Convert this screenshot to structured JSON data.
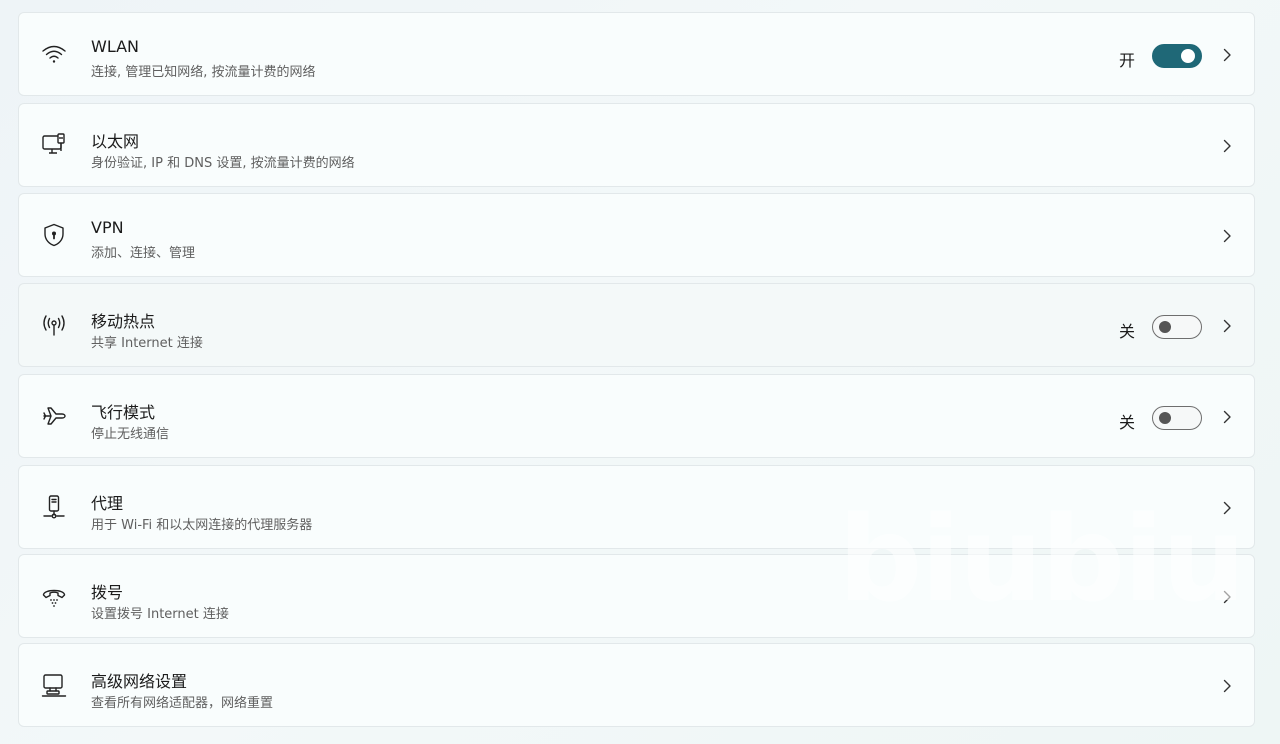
{
  "items": [
    {
      "title": "WLAN",
      "subtitle": "连接, 管理已知网络, 按流量计费的网络",
      "icon": "wifi-icon",
      "toggle": "on",
      "state": "开"
    },
    {
      "title": "以太网",
      "subtitle": "身份验证, IP 和 DNS 设置, 按流量计费的网络",
      "icon": "ethernet-icon"
    },
    {
      "title": "VPN",
      "subtitle": "添加、连接、管理",
      "icon": "shield-icon"
    },
    {
      "title": "移动热点",
      "subtitle": "共享 Internet 连接",
      "icon": "hotspot-icon",
      "toggle": "off",
      "state": "关"
    },
    {
      "title": "飞行模式",
      "subtitle": "停止无线通信",
      "icon": "airplane-icon",
      "toggle": "off",
      "state": "关"
    },
    {
      "title": "代理",
      "subtitle": "用于 Wi-Fi 和以太网连接的代理服务器",
      "icon": "proxy-icon"
    },
    {
      "title": "拨号",
      "subtitle": "设置拨号 Internet 连接",
      "icon": "dialup-icon"
    },
    {
      "title": "高级网络设置",
      "subtitle": "查看所有网络适配器，网络重置",
      "icon": "advanced-network-icon"
    }
  ],
  "watermark": "biubiu",
  "colors": {
    "toggle_on": "#1f6877",
    "toggle_off_border": "#6e6e6e"
  }
}
